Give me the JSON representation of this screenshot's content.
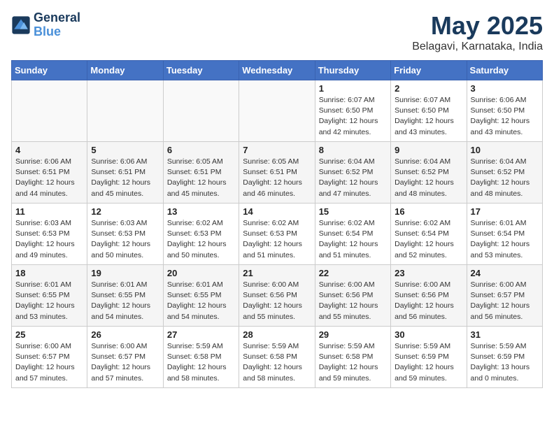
{
  "logo": {
    "line1": "General",
    "line2": "Blue"
  },
  "title": "May 2025",
  "location": "Belagavi, Karnataka, India",
  "days_of_week": [
    "Sunday",
    "Monday",
    "Tuesday",
    "Wednesday",
    "Thursday",
    "Friday",
    "Saturday"
  ],
  "weeks": [
    [
      {
        "day": "",
        "info": ""
      },
      {
        "day": "",
        "info": ""
      },
      {
        "day": "",
        "info": ""
      },
      {
        "day": "",
        "info": ""
      },
      {
        "day": "1",
        "info": "Sunrise: 6:07 AM\nSunset: 6:50 PM\nDaylight: 12 hours\nand 42 minutes."
      },
      {
        "day": "2",
        "info": "Sunrise: 6:07 AM\nSunset: 6:50 PM\nDaylight: 12 hours\nand 43 minutes."
      },
      {
        "day": "3",
        "info": "Sunrise: 6:06 AM\nSunset: 6:50 PM\nDaylight: 12 hours\nand 43 minutes."
      }
    ],
    [
      {
        "day": "4",
        "info": "Sunrise: 6:06 AM\nSunset: 6:51 PM\nDaylight: 12 hours\nand 44 minutes."
      },
      {
        "day": "5",
        "info": "Sunrise: 6:06 AM\nSunset: 6:51 PM\nDaylight: 12 hours\nand 45 minutes."
      },
      {
        "day": "6",
        "info": "Sunrise: 6:05 AM\nSunset: 6:51 PM\nDaylight: 12 hours\nand 45 minutes."
      },
      {
        "day": "7",
        "info": "Sunrise: 6:05 AM\nSunset: 6:51 PM\nDaylight: 12 hours\nand 46 minutes."
      },
      {
        "day": "8",
        "info": "Sunrise: 6:04 AM\nSunset: 6:52 PM\nDaylight: 12 hours\nand 47 minutes."
      },
      {
        "day": "9",
        "info": "Sunrise: 6:04 AM\nSunset: 6:52 PM\nDaylight: 12 hours\nand 48 minutes."
      },
      {
        "day": "10",
        "info": "Sunrise: 6:04 AM\nSunset: 6:52 PM\nDaylight: 12 hours\nand 48 minutes."
      }
    ],
    [
      {
        "day": "11",
        "info": "Sunrise: 6:03 AM\nSunset: 6:53 PM\nDaylight: 12 hours\nand 49 minutes."
      },
      {
        "day": "12",
        "info": "Sunrise: 6:03 AM\nSunset: 6:53 PM\nDaylight: 12 hours\nand 50 minutes."
      },
      {
        "day": "13",
        "info": "Sunrise: 6:02 AM\nSunset: 6:53 PM\nDaylight: 12 hours\nand 50 minutes."
      },
      {
        "day": "14",
        "info": "Sunrise: 6:02 AM\nSunset: 6:53 PM\nDaylight: 12 hours\nand 51 minutes."
      },
      {
        "day": "15",
        "info": "Sunrise: 6:02 AM\nSunset: 6:54 PM\nDaylight: 12 hours\nand 51 minutes."
      },
      {
        "day": "16",
        "info": "Sunrise: 6:02 AM\nSunset: 6:54 PM\nDaylight: 12 hours\nand 52 minutes."
      },
      {
        "day": "17",
        "info": "Sunrise: 6:01 AM\nSunset: 6:54 PM\nDaylight: 12 hours\nand 53 minutes."
      }
    ],
    [
      {
        "day": "18",
        "info": "Sunrise: 6:01 AM\nSunset: 6:55 PM\nDaylight: 12 hours\nand 53 minutes."
      },
      {
        "day": "19",
        "info": "Sunrise: 6:01 AM\nSunset: 6:55 PM\nDaylight: 12 hours\nand 54 minutes."
      },
      {
        "day": "20",
        "info": "Sunrise: 6:01 AM\nSunset: 6:55 PM\nDaylight: 12 hours\nand 54 minutes."
      },
      {
        "day": "21",
        "info": "Sunrise: 6:00 AM\nSunset: 6:56 PM\nDaylight: 12 hours\nand 55 minutes."
      },
      {
        "day": "22",
        "info": "Sunrise: 6:00 AM\nSunset: 6:56 PM\nDaylight: 12 hours\nand 55 minutes."
      },
      {
        "day": "23",
        "info": "Sunrise: 6:00 AM\nSunset: 6:56 PM\nDaylight: 12 hours\nand 56 minutes."
      },
      {
        "day": "24",
        "info": "Sunrise: 6:00 AM\nSunset: 6:57 PM\nDaylight: 12 hours\nand 56 minutes."
      }
    ],
    [
      {
        "day": "25",
        "info": "Sunrise: 6:00 AM\nSunset: 6:57 PM\nDaylight: 12 hours\nand 57 minutes."
      },
      {
        "day": "26",
        "info": "Sunrise: 6:00 AM\nSunset: 6:57 PM\nDaylight: 12 hours\nand 57 minutes."
      },
      {
        "day": "27",
        "info": "Sunrise: 5:59 AM\nSunset: 6:58 PM\nDaylight: 12 hours\nand 58 minutes."
      },
      {
        "day": "28",
        "info": "Sunrise: 5:59 AM\nSunset: 6:58 PM\nDaylight: 12 hours\nand 58 minutes."
      },
      {
        "day": "29",
        "info": "Sunrise: 5:59 AM\nSunset: 6:58 PM\nDaylight: 12 hours\nand 59 minutes."
      },
      {
        "day": "30",
        "info": "Sunrise: 5:59 AM\nSunset: 6:59 PM\nDaylight: 12 hours\nand 59 minutes."
      },
      {
        "day": "31",
        "info": "Sunrise: 5:59 AM\nSunset: 6:59 PM\nDaylight: 13 hours\nand 0 minutes."
      }
    ]
  ]
}
